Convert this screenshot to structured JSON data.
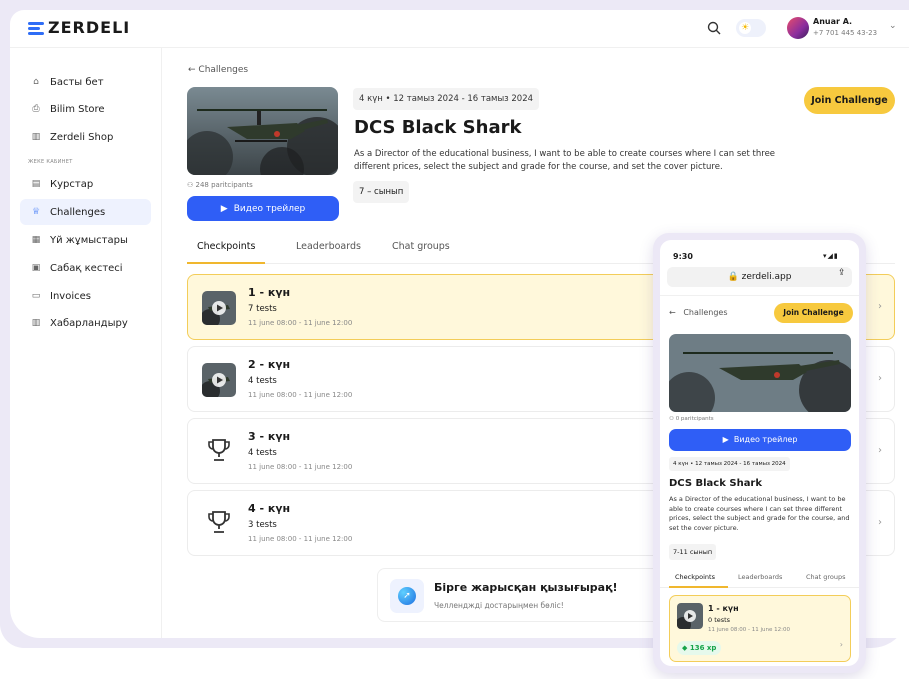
{
  "brand": {
    "name": "ZERDELI",
    "accent": "#2f5ef6",
    "yellow": "#f7c93e"
  },
  "header": {
    "user_name": "Anuar A.",
    "user_phone": "+7 701 445 43-23"
  },
  "sidebar": {
    "section_label": "ЖЕКЕ КАБИНЕТ",
    "items": [
      {
        "label": "Басты бет",
        "icon": "home-icon"
      },
      {
        "label": "Bilim Store",
        "icon": "store-icon"
      },
      {
        "label": "Zerdeli Shop",
        "icon": "shop-icon"
      },
      {
        "label": "Курстар",
        "icon": "courses-icon"
      },
      {
        "label": "Challenges",
        "icon": "trophy-icon"
      },
      {
        "label": "Үй жұмыстары",
        "icon": "homework-icon"
      },
      {
        "label": "Сабақ кестесі",
        "icon": "calendar-icon"
      },
      {
        "label": "Invoices",
        "icon": "invoice-icon"
      },
      {
        "label": "Хабарландыру",
        "icon": "notification-icon"
      }
    ]
  },
  "challenge": {
    "back_label": "Challenges",
    "participants": "248 paritcipants",
    "trailer_label": "Видео трейлер",
    "date_range": "4 күн • 12 тамыз 2024 - 16 тамыз 2024",
    "title": "DCS Black Shark",
    "description": "As a Director of the educational business, I want to be able to create courses where I can set three different prices, select the subject and grade for the course, and set the cover picture.",
    "grade": "7 – сынып",
    "join_label": "Join Challenge"
  },
  "tabs": [
    "Checkpoints",
    "Leaderboards",
    "Chat groups"
  ],
  "checkpoints": [
    {
      "title": "1 - күн",
      "tests": "7 tests",
      "date": "11 june 08:00 - 11 june 12:00"
    },
    {
      "title": "2 - күн",
      "tests": "4 tests",
      "date": "11 june 08:00 - 11 june 12:00"
    },
    {
      "title": "3 - күн",
      "tests": "4 tests",
      "date": "11 june 08:00 - 11 june 12:00"
    },
    {
      "title": "4 - күн",
      "tests": "3 tests",
      "date": "11 june 08:00 - 11 june 12:00"
    }
  ],
  "banner": {
    "title": "Бірге жарысқан қызығырақ!",
    "subtitle": "Челленджді достарыңмен бөліс!"
  },
  "phone": {
    "time": "9:30",
    "url": "zerdeli.app",
    "back_label": "Challenges",
    "join_label": "Join Challenge",
    "participants": "0 paritcipants",
    "trailer_label": "Видео трейлер",
    "date_range": "4 күн • 12 тамыз 2024 - 16 тамыз 2024",
    "title": "DCS Black Shark",
    "description": "As a Director of the educational business, I want to be able to create courses where I can set three different prices, select the subject and grade for the course, and set the cover picture.",
    "grade": "7-11 сынып",
    "tabs": [
      "Checkpoints",
      "Leaderboards",
      "Chat groups"
    ],
    "checkpoint": {
      "title": "1 - күн",
      "tests": "0 tests",
      "date": "11 june 08:00 - 11 june 12:00",
      "xp": "136 xp"
    }
  }
}
